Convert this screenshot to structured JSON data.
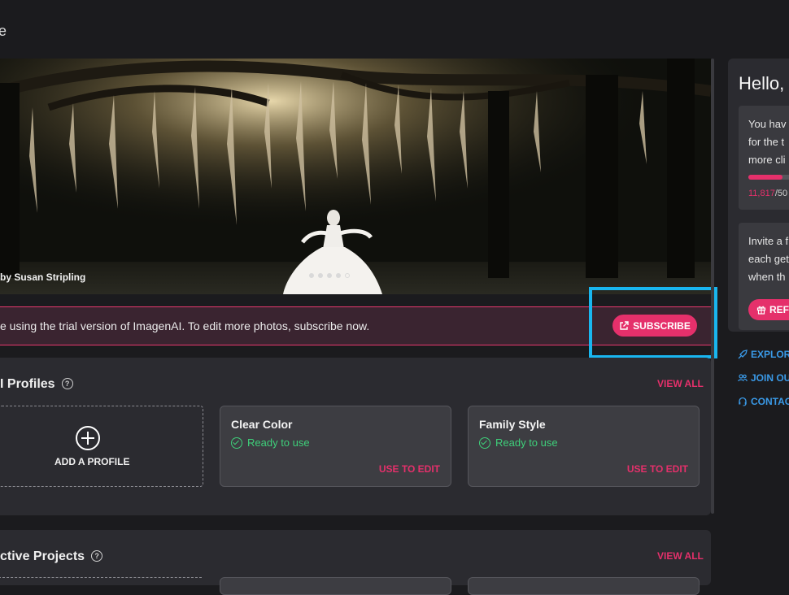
{
  "header": {
    "logo_fragment": "e"
  },
  "hero": {
    "photo_credit": "by Susan Stripling",
    "carousel": {
      "slide_count": 5,
      "active_index": 4
    }
  },
  "trial_banner": {
    "message": "e using the trial version of ImagenAI. To edit more photos, subscribe now.",
    "subscribe_label": "SUBSCRIBE"
  },
  "profiles_section": {
    "title": "I Profiles",
    "view_all": "VIEW ALL",
    "add_profile_label": "ADD A PROFILE",
    "cards": [
      {
        "name": "Clear Color",
        "status": "Ready to use",
        "action": "USE TO EDIT"
      },
      {
        "name": "Family Style",
        "status": "Ready to use",
        "action": "USE TO EDIT"
      }
    ]
  },
  "projects_section": {
    "title": "ctive Projects",
    "view_all": "VIEW ALL"
  },
  "sidebar": {
    "greeting": "Hello,",
    "usage_card": {
      "lines": [
        "You hav",
        "for the t",
        "more cli"
      ],
      "credits_used": "11,817",
      "credits_total": "/50",
      "progress_fraction": 0.7
    },
    "invite_card": {
      "lines": [
        "Invite a f",
        "each get",
        "when th"
      ],
      "button_label": "REF"
    },
    "links": [
      "EXPLORE",
      "JOIN OU",
      "CONTACT"
    ]
  },
  "colors": {
    "accent": "#e5306b",
    "success": "#3ecf7a",
    "link": "#3a9ae8",
    "highlight": "#19b6ef"
  }
}
